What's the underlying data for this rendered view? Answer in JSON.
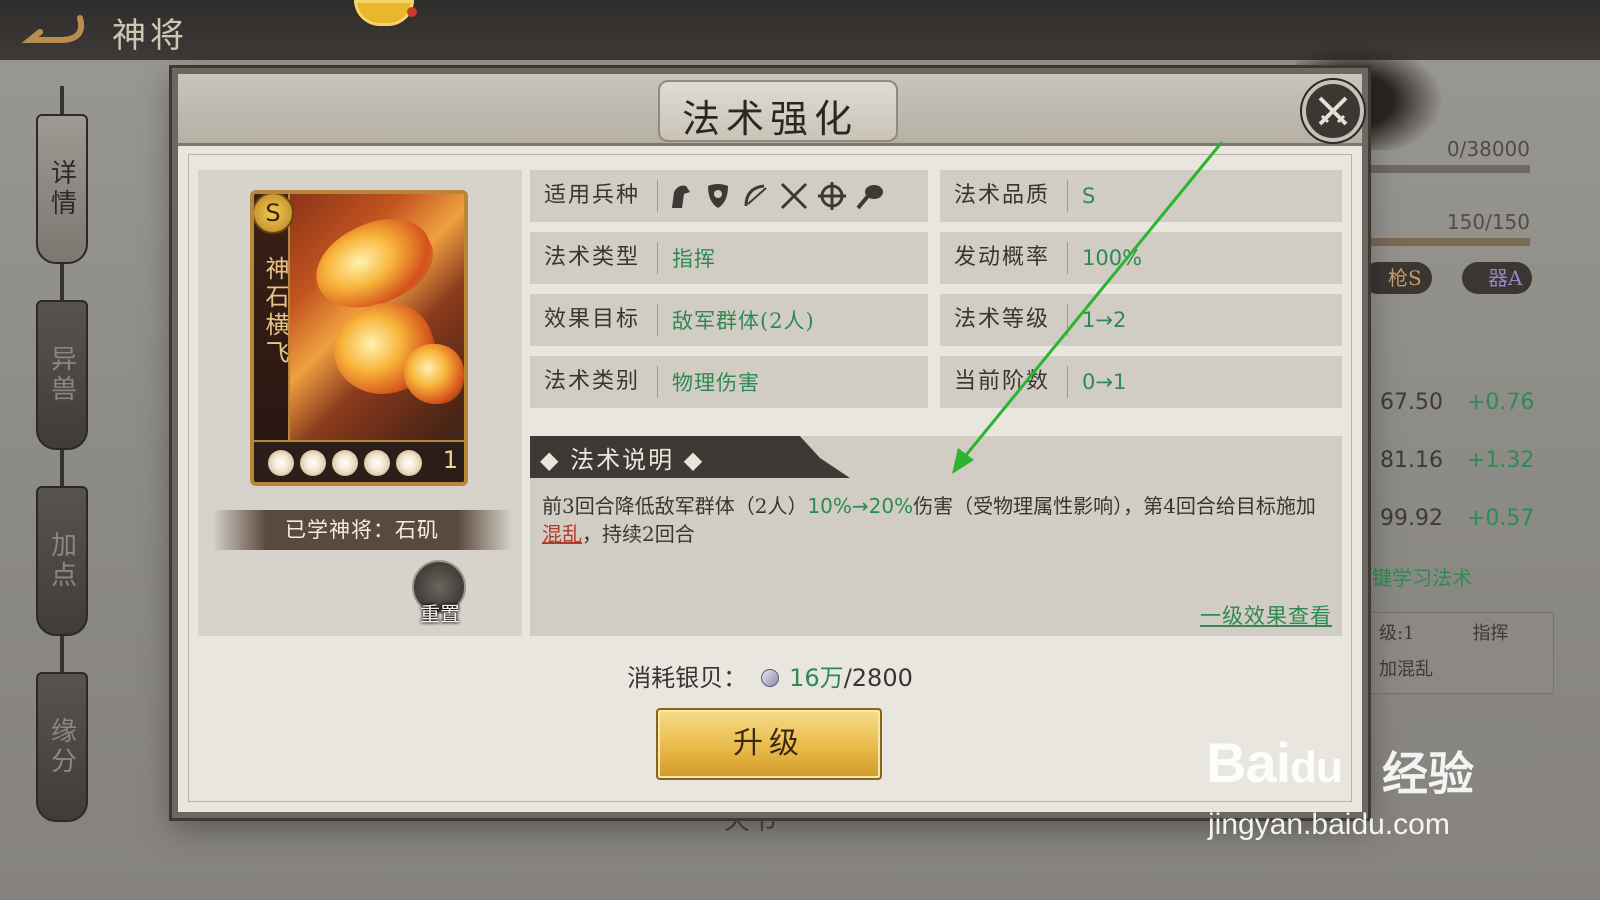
{
  "screen": {
    "title": "神将"
  },
  "side_nav": [
    {
      "label": "详情",
      "active": true
    },
    {
      "label": "异兽",
      "active": false
    },
    {
      "label": "加点",
      "active": false
    },
    {
      "label": "缘分",
      "active": false
    }
  ],
  "background": {
    "progress_1": "0/38000",
    "progress_2": "150/150",
    "tags": [
      "枪S",
      "器A"
    ],
    "stats": [
      {
        "value": "67.50",
        "delta": "+0.76"
      },
      {
        "value": "81.16",
        "delta": "+1.32"
      },
      {
        "value": "99.92",
        "delta": "+0.57"
      }
    ],
    "learn_link": "键学习法术",
    "card_line1_left": "级:1",
    "card_line1_right": "指挥",
    "card_line2": "加混乱",
    "bottom_texts": [
      "天书"
    ]
  },
  "modal": {
    "title": "法术强化",
    "skill_card": {
      "name": "神石横飞",
      "grade": "S",
      "level": "1"
    },
    "learned_general": "已学神将：石矶",
    "reset_label": "重置",
    "info": {
      "troop_label": "适用兵种",
      "troop_icons": [
        "cavalry-icon",
        "shield-icon",
        "bow-icon",
        "spear-icon",
        "crosshair-icon",
        "instrument-icon"
      ],
      "quality_label": "法术品质",
      "quality_value": "S",
      "type_label": "法术类型",
      "type_value": "指挥",
      "chance_label": "发动概率",
      "chance_value": "100%",
      "target_label": "效果目标",
      "target_value": "敌军群体(2人)",
      "level_label": "法术等级",
      "level_value": "1→2",
      "category_label": "法术类别",
      "category_value": "物理伤害",
      "stage_label": "当前阶数",
      "stage_value": "0→1"
    },
    "description": {
      "title": "法术说明",
      "text_1": "前3回合降低敌军群体（2人）",
      "text_highlight": "10%→20%",
      "text_2": "伤害（受物理属性影响），第4回合给目标施加",
      "text_status": "混乱",
      "text_3": "，持续2回合",
      "link": "一级效果查看"
    },
    "cost": {
      "label": "消耗银贝：",
      "have": "16万",
      "need": "/2800"
    },
    "upgrade_label": "升级"
  },
  "watermark": {
    "brand": "Bai",
    "brand_tail": "du",
    "cn": "经验",
    "url": "jingyan.baidu.com"
  },
  "colors": {
    "accent_green": "#2e8a52",
    "status_red": "#b43a2e",
    "button_gold": "#e8bb4a",
    "annotation_arrow": "#2bb52f"
  }
}
